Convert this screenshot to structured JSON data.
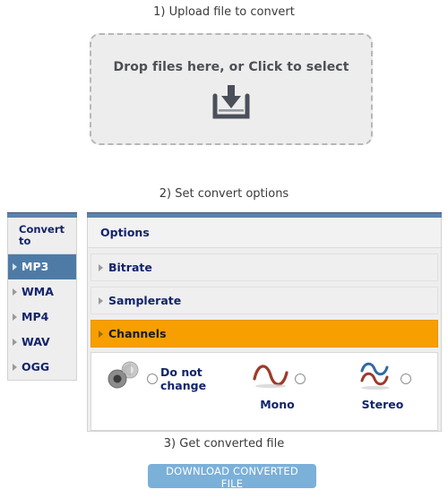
{
  "steps": {
    "upload_heading": "1) Upload file to convert",
    "options_heading": "2) Set convert options",
    "download_heading": "3) Get converted file"
  },
  "dropzone": {
    "text": "Drop files here, or Click to select",
    "icon": "download-tray-icon"
  },
  "sidebar": {
    "title": "Convert to",
    "formats": [
      {
        "label": "MP3",
        "selected": true
      },
      {
        "label": "WMA",
        "selected": false
      },
      {
        "label": "MP4",
        "selected": false
      },
      {
        "label": "WAV",
        "selected": false
      },
      {
        "label": "OGG",
        "selected": false
      }
    ]
  },
  "options": {
    "header": "Options",
    "sections": [
      {
        "label": "Bitrate",
        "active": false
      },
      {
        "label": "Samplerate",
        "active": false
      },
      {
        "label": "Channels",
        "active": true
      }
    ],
    "channels": [
      {
        "label": "Do not change",
        "icon": "speakers-icon",
        "selected": false
      },
      {
        "label": "Mono",
        "icon": "mono-wave-icon",
        "selected": false
      },
      {
        "label": "Stereo",
        "icon": "stereo-wave-icon",
        "selected": false
      }
    ]
  },
  "download": {
    "button_label": "DOWNLOAD CONVERTED FILE"
  },
  "colors": {
    "accent_blue": "#4e7ba6",
    "topbar_blue": "#5d82ab",
    "active_orange": "#f79f00",
    "navy_text": "#12246b",
    "button_blue": "#7bb0d8"
  }
}
